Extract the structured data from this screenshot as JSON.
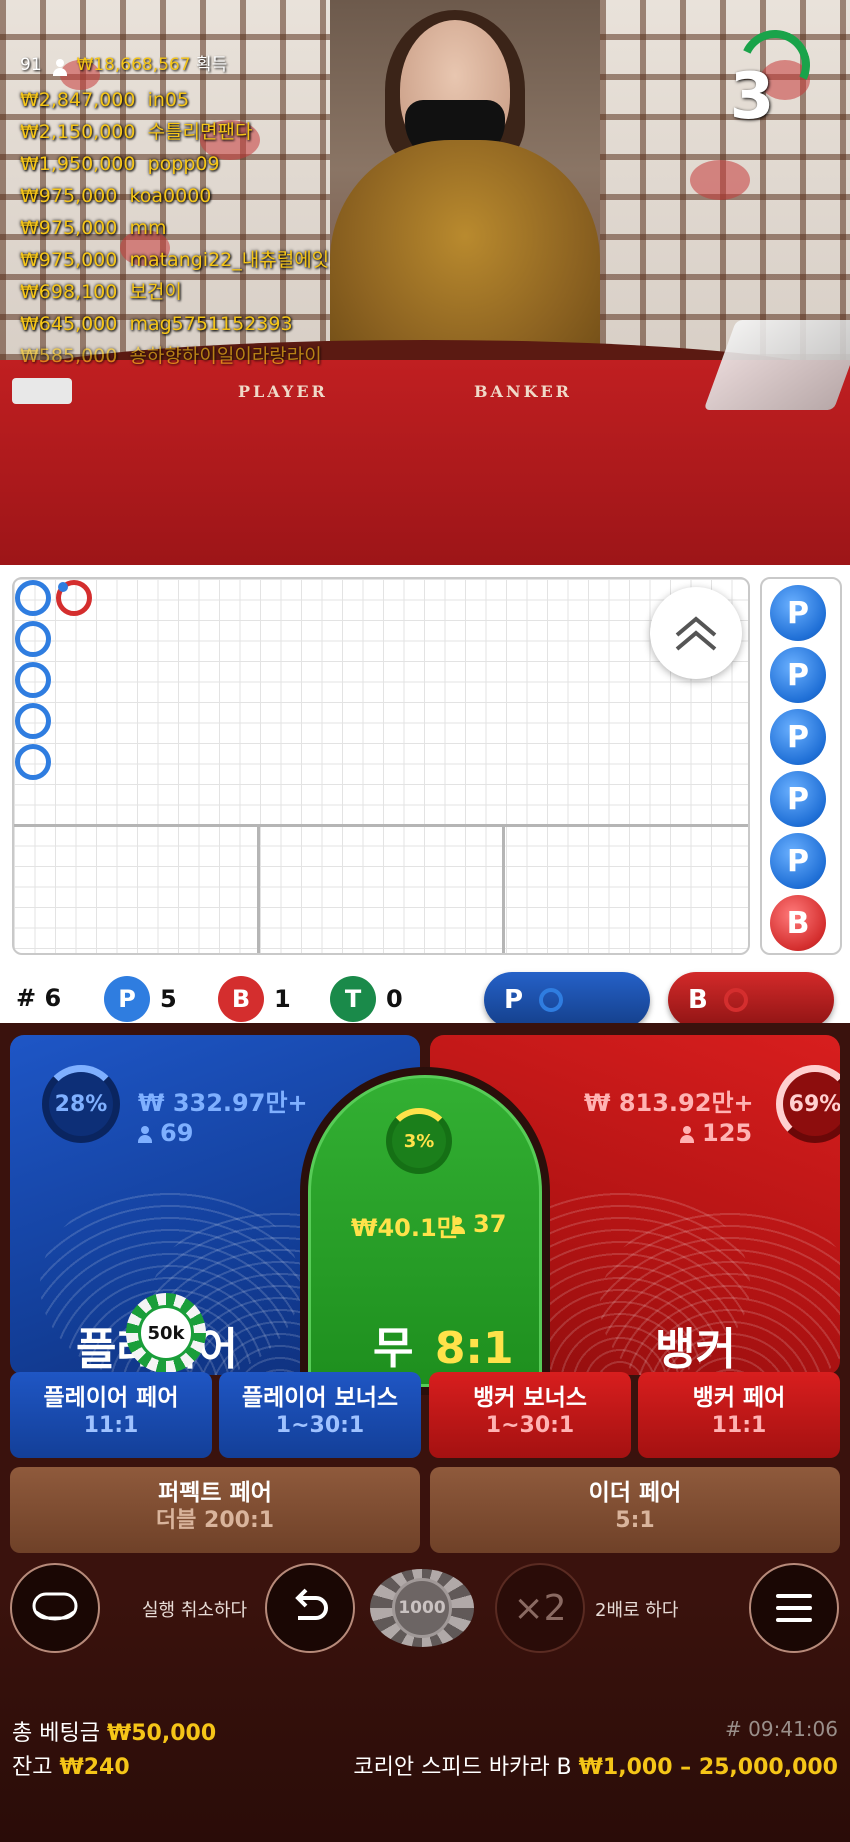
{
  "video": {
    "viewer_count": "91",
    "header_amount": "₩18,668,567",
    "header_suffix": "획득",
    "table_labels": [
      "PLAYER",
      "BANKER"
    ],
    "countdown": "3",
    "winners": [
      {
        "amount": "₩2,847,000",
        "name": "in05"
      },
      {
        "amount": "₩2,150,000",
        "name": "수틀리면팬다"
      },
      {
        "amount": "₩1,950,000",
        "name": "popp09"
      },
      {
        "amount": "₩975,000",
        "name": "koa0000"
      },
      {
        "amount": "₩975,000",
        "name": "mm"
      },
      {
        "amount": "₩975,000",
        "name": "matangi22_내츄럴에잇"
      },
      {
        "amount": "₩698,100",
        "name": "보건이"
      },
      {
        "amount": "₩645,000",
        "name": "mag5751152393"
      },
      {
        "amount": "₩585,000",
        "name": "숑하향하이일이라랑라이"
      }
    ]
  },
  "roadmap": {
    "round_label": "# 6",
    "player_count": "5",
    "banker_count": "1",
    "tie_count": "0",
    "player_letter": "P",
    "banker_letter": "B",
    "tie_letter": "T",
    "side_results": [
      "P",
      "P",
      "P",
      "P",
      "P",
      "B"
    ],
    "predict_player": "P",
    "predict_banker": "B"
  },
  "betting": {
    "player": {
      "percent": "28%",
      "amount": "₩ 332.97만+",
      "players": "69",
      "label": "플레이어"
    },
    "banker": {
      "percent": "69%",
      "amount": "₩ 813.92만+",
      "players": "125",
      "label": "뱅커"
    },
    "tie": {
      "percent": "3%",
      "amount": "₩40.1만",
      "players": "37",
      "label": "무",
      "odds": "8:1"
    },
    "placed_chip": "50k",
    "side_bets": [
      {
        "label": "플레이어 페어",
        "odds": "11:1"
      },
      {
        "label": "플레이어 보너스",
        "odds": "1~30:1"
      },
      {
        "label": "뱅커 보너스",
        "odds": "1~30:1"
      },
      {
        "label": "뱅커 페어",
        "odds": "11:1"
      }
    ],
    "perfect_pair": {
      "label": "퍼펙트 페어",
      "odds": "더블 200:1"
    },
    "either_pair": {
      "label": "이더 페어",
      "odds": "5:1"
    }
  },
  "controls": {
    "undo_label": "실행 취소하다",
    "chip_value": "1000",
    "double_label": "2배로 하다",
    "double_icon": "×2"
  },
  "footer": {
    "total_bet_label": "총 베팅금",
    "total_bet_value": "₩50,000",
    "balance_label": "잔고",
    "balance_value": "₩240",
    "time": "# 09:41:06",
    "table_name": "코리안 스피드 바카라 B",
    "limits": "₩1,000 – 25,000,000"
  },
  "colors": {
    "player_blue": "#1e56c6",
    "banker_red": "#d81e1e",
    "tie_green": "#2aa52a",
    "gold": "#f5c518"
  }
}
